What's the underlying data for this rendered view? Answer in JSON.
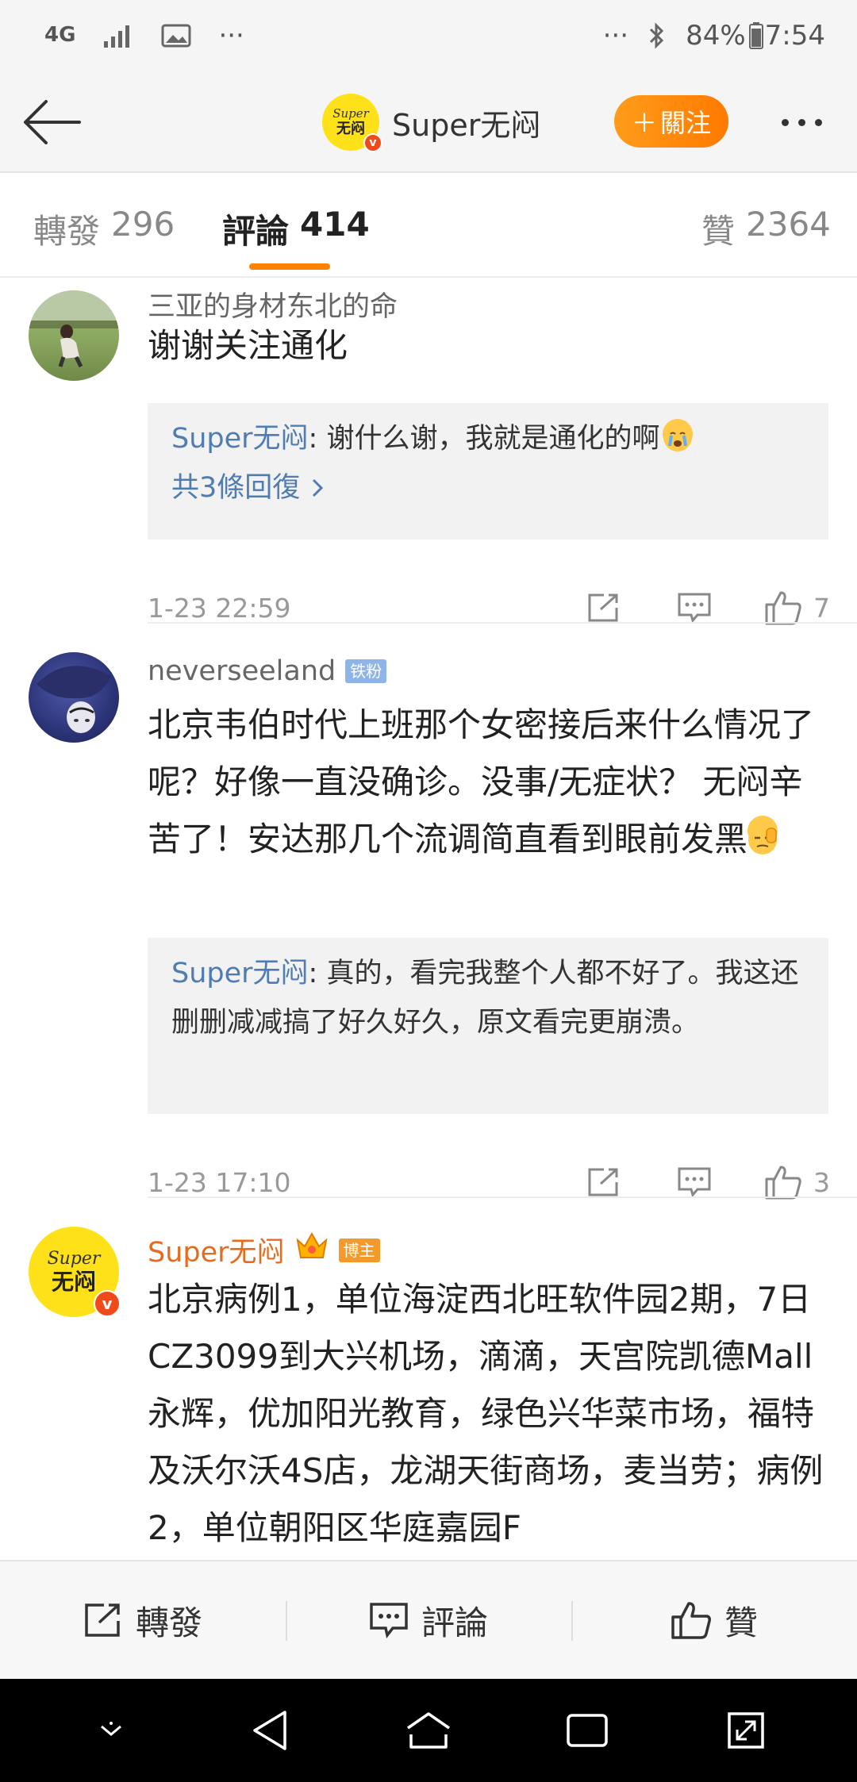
{
  "status_bar": {
    "network": "4G",
    "overflow": "···",
    "overflow_right": "···",
    "battery": "84%",
    "time": "7:54"
  },
  "header": {
    "profile_name": "Super无闷",
    "avatar_text_top": "Super",
    "avatar_text_bottom": "无闷",
    "verified_mark": "v",
    "follow_label": "關注",
    "follow_plus": "＋"
  },
  "tabs": [
    {
      "label": "轉發",
      "count": "296"
    },
    {
      "label": "評論",
      "count": "414"
    },
    {
      "label": "贊",
      "count": "2364"
    }
  ],
  "comments": [
    {
      "name": "三亚的身材东北的命",
      "text": "谢谢关注通化",
      "reply_author": "Super无闷",
      "reply_sep": ": ",
      "reply_text": "谢什么谢，我就是通化的啊",
      "reply_more": "共3條回復",
      "time": "1-23 22:59",
      "likes": "7"
    },
    {
      "name": "neverseeland",
      "tag": "铁粉",
      "text": "北京韦伯时代上班那个女密接后来什么情况了呢？好像一直没确诊。没事/无症状？ 无闷辛苦了！安达那几个流调简直看到眼前发黑",
      "reply_author": "Super无闷",
      "reply_sep": ": ",
      "reply_text": "真的，看完我整个人都不好了。我这还删删减减搞了好久好久，原文看完更崩溃。",
      "time": "1-23 17:10",
      "likes": "3"
    },
    {
      "name": "Super无闷",
      "tag": "博主",
      "avatar_text_top": "Super",
      "avatar_text_bottom": "无闷",
      "text": "北京病例1，单位海淀西北旺软件园2期，7日CZ3099到大兴机场，滴滴，天宫院凯德Mall永辉，优加阳光教育，绿色兴华菜市场，福特及沃尔沃4S店，龙湖天街商场，麦当劳；病例2，单位朝阳区华庭嘉园F"
    }
  ],
  "bottom_bar": {
    "repost": "轉發",
    "comment": "評論",
    "like": "贊"
  },
  "colors": {
    "accent_orange": "#ff8200",
    "link_blue": "#4f7cb3",
    "author_orange": "#e76b1c"
  }
}
